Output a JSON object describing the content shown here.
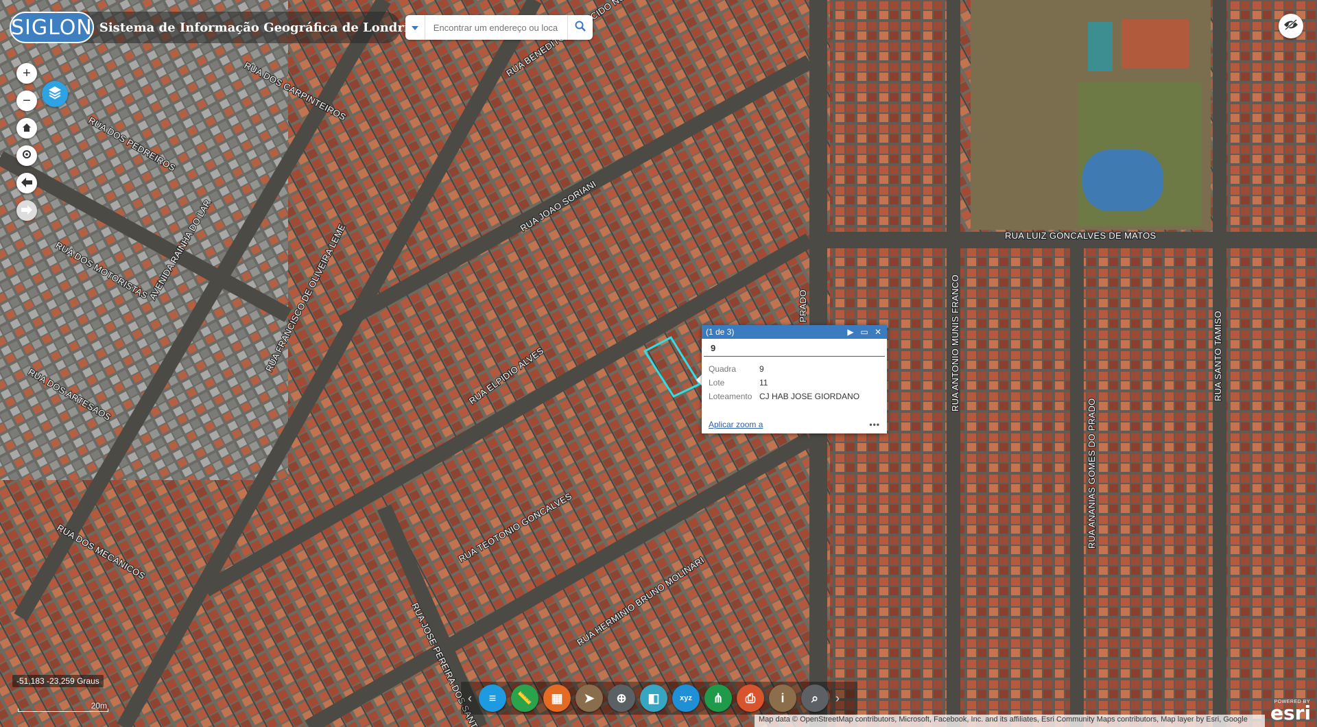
{
  "header": {
    "logo": "SIGLON",
    "title": "Sistema de Informação Geográfica de Londrina"
  },
  "search": {
    "placeholder": "Encontrar um endereço ou loca"
  },
  "streets": [
    "RUA DOS CARPINTEIROS",
    "RUA BENEDITO APARECIDO NOBREGA",
    "RUA DOS PEDREIROS",
    "RUA JOAO SORIANI",
    "RUA DOS MOTORISTAS",
    "AVENIDA RAINHA DO LAR",
    "RUA FRANCISCO DE OLIVEIRA LEME",
    "RUA DOS ARTESAOS",
    "RUA ELPIDIO ALVES",
    "RUA DOS MECANICOS",
    "RUA TEOTONIO GONCALVES",
    "RUA JOSE PEREIRA DOS SANTOS",
    "RUA HERMINIO BRUNO MOLINARI",
    "PRADO",
    "RUA LUIZ GONCALVES DE MATOS",
    "RUA ANTONIO MUNIS FRANCO",
    "RUA ANANIAS GOMES DO PRADO",
    "RUA SANTO TAMISO"
  ],
  "popup": {
    "counter": "(1 de 3)",
    "title": "9",
    "fields": [
      {
        "key": "Quadra",
        "value": "9"
      },
      {
        "key": "Lote",
        "value": "11"
      },
      {
        "key": "Loteamento",
        "value": "CJ HAB JOSE GIORDANO"
      }
    ],
    "zoom_link": "Aplicar zoom a",
    "more": "•••"
  },
  "coords": "-51,183 -23,259 Graus",
  "scale_label": "20m",
  "attribution": "Map data © OpenStreetMap contributors, Microsoft, Facebook, Inc. and its affiliates, Esri Community Maps contributors, Map layer by Esri, Google",
  "esri": {
    "powered": "POWERED BY",
    "brand": "esri"
  },
  "toolbar": {
    "tools": [
      {
        "icon": "layers-icon",
        "color": "#1e9ae0"
      },
      {
        "icon": "ruler-icon",
        "color": "#2ba24c"
      },
      {
        "icon": "basemap-gallery-icon",
        "color": "#e36b23"
      },
      {
        "icon": "send-icon",
        "color": "#8a6d4d"
      },
      {
        "icon": "location-search-icon",
        "color": "#5b6064"
      },
      {
        "icon": "swipe-icon",
        "color": "#37a6c2"
      },
      {
        "icon": "xyz-coordinates-icon",
        "color": "#1f8fd6"
      },
      {
        "icon": "share-icon",
        "color": "#1f9a4a"
      },
      {
        "icon": "print-icon",
        "color": "#d9532c"
      },
      {
        "icon": "info-icon",
        "color": "#8c6e4b"
      },
      {
        "icon": "query-icon",
        "color": "#5d6165"
      }
    ]
  }
}
